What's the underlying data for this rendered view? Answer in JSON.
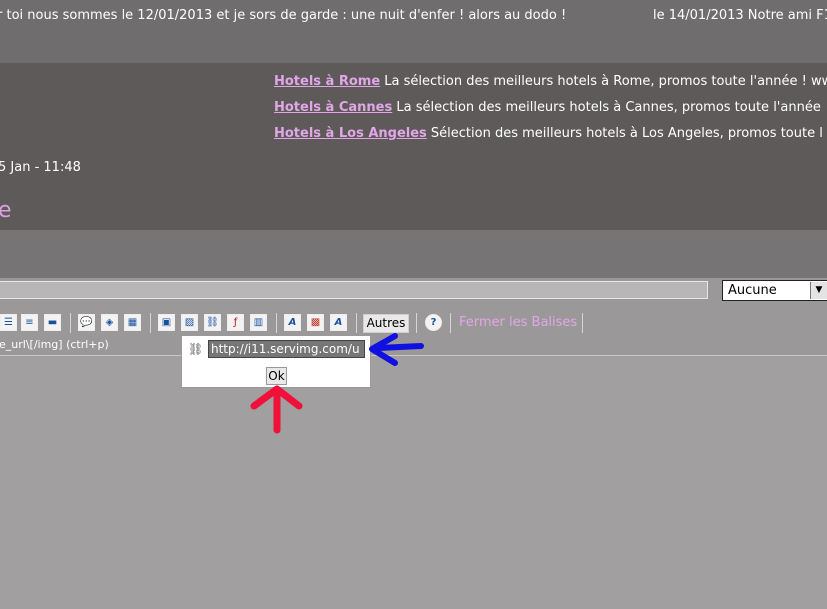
{
  "ticker": {
    "text_1": "r toi nous sommes le 12/01/2013 et je sors de garde : une nuit d'enfer ! alors au dodo !",
    "text_2": "le 14/01/2013 Notre ami F1"
  },
  "ads": [
    {
      "link": "Hotels à Rome",
      "text": " La sélection des meilleurs hotels à Rome, promos toute l'année ! ww"
    },
    {
      "link": "Hotels à Cannes",
      "text": " La sélection des meilleurs hotels à Cannes, promos toute l'année"
    },
    {
      "link": "Hotels à Los Angeles",
      "text": " Sélection des meilleurs hotels à Los Angeles, promos toute l"
    }
  ],
  "post": {
    "date": "5 Jan - 11:48",
    "title_fragment": "e"
  },
  "form": {
    "icon_select_value": "Aucune"
  },
  "toolbar": {
    "buttons": [
      {
        "name": "bullet-list-icon",
        "glyph": "☰"
      },
      {
        "name": "numbered-list-icon",
        "glyph": "≡"
      },
      {
        "name": "horizontal-line-icon",
        "glyph": "▬"
      },
      {
        "name": "quote-icon",
        "glyph": "💬"
      },
      {
        "name": "code-icon",
        "glyph": "◈"
      },
      {
        "name": "table-icon",
        "glyph": "▦"
      },
      {
        "name": "image-host-icon",
        "glyph": "▣"
      },
      {
        "name": "image-icon",
        "glyph": "▨"
      },
      {
        "name": "link-icon",
        "glyph": "⛓"
      },
      {
        "name": "flash-icon",
        "glyph": "ƒ"
      },
      {
        "name": "video-icon",
        "glyph": "▥"
      },
      {
        "name": "font-icon",
        "glyph": "A"
      },
      {
        "name": "color-icon",
        "glyph": "▩"
      },
      {
        "name": "font-size-icon",
        "glyph": "A"
      },
      {
        "name": "help-icon",
        "glyph": "?"
      }
    ],
    "autres_label": "Autres",
    "fermer_label": "Fermer les Balises"
  },
  "help_text": "e_url\\[/img] (ctrl+p)",
  "popup": {
    "url_value": "http://i11.servimg.com/u",
    "ok_label": "Ok"
  },
  "annotations": {
    "blue_arrow_color": "#1010e0",
    "red_arrow_color": "#f0103a"
  }
}
